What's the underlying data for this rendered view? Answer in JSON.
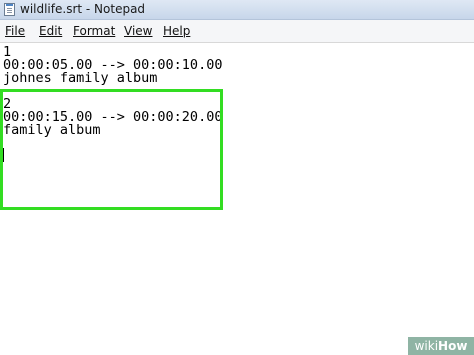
{
  "window": {
    "title": "wildlife.srt - Notepad"
  },
  "menu": {
    "items": [
      {
        "label": "File"
      },
      {
        "label": "Edit"
      },
      {
        "label": "Format"
      },
      {
        "label": "View"
      },
      {
        "label": "Help"
      }
    ]
  },
  "editor": {
    "lines": [
      "1",
      "00:00:05.00 --> 00:00:10.00",
      "johnes family album",
      "",
      "2",
      "00:00:15.00 --> 00:00:20.00",
      "family album",
      ""
    ],
    "highlight_color": "#33dd22"
  },
  "watermark": {
    "prefix": "wiki",
    "suffix": "How"
  }
}
